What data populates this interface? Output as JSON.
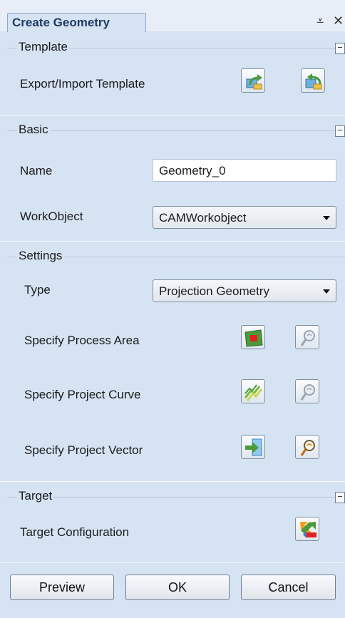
{
  "panel": {
    "title": "Create Geometry"
  },
  "window_controls": {
    "pin_glyph": "⩡",
    "close_glyph": "✕"
  },
  "sections": {
    "template": {
      "title": "Template",
      "collapse_glyph": "−",
      "export_import_label": "Export/Import Template"
    },
    "basic": {
      "title": "Basic",
      "collapse_glyph": "−",
      "name_label": "Name",
      "name_value": "Geometry_0",
      "workobject_label": "WorkObject",
      "workobject_value": "CAMWorkobject"
    },
    "settings": {
      "title": "Settings",
      "type_label": "Type",
      "type_value": "Projection Geometry",
      "process_area_label": "Specify Process Area",
      "project_curve_label": "Specify Project Curve",
      "project_vector_label": "Specify Project Vector"
    },
    "target": {
      "title": "Target",
      "collapse_glyph": "−",
      "configuration_label": "Target Configuration"
    }
  },
  "footer": {
    "preview_label": "Preview",
    "ok_label": "OK",
    "cancel_label": "Cancel"
  },
  "icons": {
    "export_template": "export-template-icon",
    "import_template": "import-template-icon",
    "process_area": "process-area-icon",
    "project_curve": "project-curve-icon",
    "project_vector": "project-vector-icon",
    "inspect": "magnifier-icon",
    "target_configuration": "target-configuration-icon"
  },
  "colors": {
    "panel_background": "#d6e3f3",
    "title_text": "#1d3b66",
    "accent_green": "#4c9a3a",
    "accent_red": "#e0211d"
  }
}
